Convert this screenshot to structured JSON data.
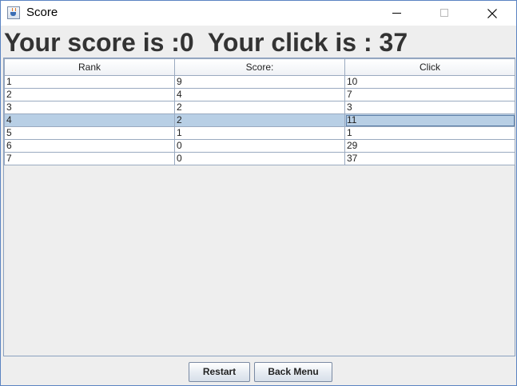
{
  "window": {
    "title": "Score",
    "icon": "java-cup-icon",
    "controls": {
      "minimize": "minimize-icon",
      "maximize": "maximize-icon",
      "close": "close-icon"
    }
  },
  "heading": "Your score is :0  Your click is : 37",
  "table": {
    "columns": [
      "Rank",
      "Score:",
      "Click"
    ],
    "rows": [
      [
        "1",
        "9",
        "10"
      ],
      [
        "2",
        "4",
        "7"
      ],
      [
        "3",
        "2",
        "3"
      ],
      [
        "4",
        "2",
        "11"
      ],
      [
        "5",
        "1",
        "1"
      ],
      [
        "6",
        "0",
        "29"
      ],
      [
        "7",
        "0",
        "37"
      ]
    ],
    "selected_row_index": 3
  },
  "buttons": {
    "restart": "Restart",
    "back_menu": "Back Menu"
  },
  "colors": {
    "selection": "#b8cfe5",
    "heading": "#333333",
    "panel_background": "#eeeeee"
  }
}
